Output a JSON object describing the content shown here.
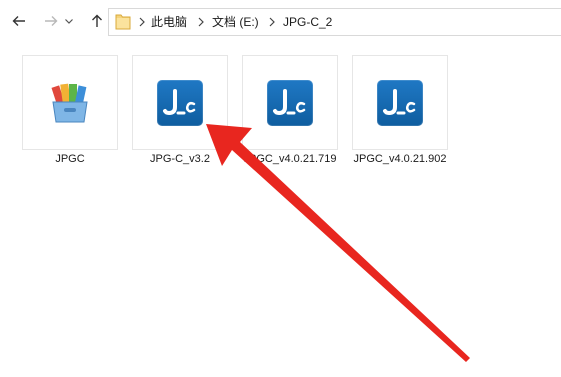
{
  "navigation": {
    "back_icon": "arrow-left-icon",
    "forward_icon": "arrow-right-icon",
    "history_icon": "chevron-down-icon",
    "up_icon": "arrow-up-icon"
  },
  "breadcrumb": {
    "folder_icon": "folder-icon",
    "items": [
      "此电脑",
      "文档 (E:)",
      "JPG-C_2"
    ],
    "separator_icon": "chevron-right-icon"
  },
  "files": [
    {
      "name": "JPGC",
      "icon": "package-icon"
    },
    {
      "name": "JPG-C_v3.2",
      "icon": "jpgc-app-icon"
    },
    {
      "name": "JPGC_v4.0.21.719",
      "icon": "jpgc-app-icon"
    },
    {
      "name": "JPGC_v4.0.21.902",
      "icon": "jpgc-app-icon"
    }
  ],
  "annotation": {
    "color": "#e8261f",
    "icon": "red-arrow-icon"
  }
}
